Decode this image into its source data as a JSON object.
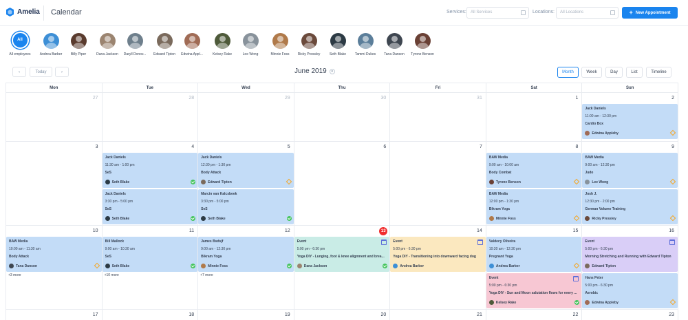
{
  "header": {
    "logo_text": "Amelia",
    "page_title": "Calendar",
    "services_label": "Services:",
    "services_placeholder": "All Services",
    "locations_label": "Locations:",
    "locations_placeholder": "All Locations",
    "new_button_label": "New Appointment",
    "accent_color": "#1a84ee"
  },
  "employees": [
    {
      "name": "All employees",
      "initials": "All",
      "selected": true
    },
    {
      "name": "Andrea Barber",
      "color": "#3d8fd6"
    },
    {
      "name": "Billy Piper",
      "color": "#5a3b2e"
    },
    {
      "name": "Dana Jackson",
      "color": "#9b8470"
    },
    {
      "name": "Daryll Donov...",
      "color": "#6e7f8c"
    },
    {
      "name": "Edward Tipton",
      "color": "#7a6a5c"
    },
    {
      "name": "Edwina Appl...",
      "color": "#a06b55"
    },
    {
      "name": "Kelsey Rake",
      "color": "#4e5a3a"
    },
    {
      "name": "Lee Wong",
      "color": "#88929b"
    },
    {
      "name": "Minnie Foss",
      "color": "#b07a4a"
    },
    {
      "name": "Ricky Pressley",
      "color": "#6b4a3c"
    },
    {
      "name": "Seth Blake",
      "color": "#2c3a44"
    },
    {
      "name": "Tammi Dukes",
      "color": "#5b7e9a"
    },
    {
      "name": "Tana Danson",
      "color": "#3e4650"
    },
    {
      "name": "Tyrone Benson",
      "color": "#6a4035"
    }
  ],
  "nav": {
    "prev": "‹",
    "today": "Today",
    "next": "›",
    "month_title": "June 2019",
    "dropdown": "▾",
    "views": [
      {
        "label": "Month",
        "active": true
      },
      {
        "label": "Week",
        "active": false
      },
      {
        "label": "Day",
        "active": false
      },
      {
        "label": "List",
        "active": false
      },
      {
        "label": "Timeline",
        "active": false
      }
    ]
  },
  "calendar": {
    "weekdays": [
      "Mon",
      "Tue",
      "Wed",
      "Thu",
      "Fri",
      "Sat",
      "Sun"
    ],
    "weeks": [
      {
        "days": [
          "27",
          "28",
          "29",
          "30",
          "31",
          "1",
          "2"
        ],
        "muted": [
          true,
          true,
          true,
          true,
          true,
          false,
          false
        ]
      },
      {
        "days": [
          "3",
          "4",
          "5",
          "6",
          "7",
          "8",
          "9"
        ]
      },
      {
        "days": [
          "10",
          "11",
          "12",
          "13",
          "14",
          "15",
          "16"
        ],
        "today_index": 3
      },
      {
        "days": [
          "17",
          "18",
          "19",
          "20",
          "21",
          "22",
          "23"
        ]
      }
    ],
    "more": [
      {
        "week": 2,
        "day": 0,
        "text": "+3 more"
      },
      {
        "week": 2,
        "day": 1,
        "text": "+10 more"
      },
      {
        "week": 2,
        "day": 2,
        "text": "+7 more"
      }
    ],
    "appointments": [
      {
        "week": 0,
        "day": 6,
        "slot": 0,
        "color": "blue",
        "title": "Jack Daniels",
        "time": "11:00 am - 12:30 pm",
        "service": "Cardio Box",
        "employee": "Edwina Appleby",
        "avatar": "#a06b55",
        "status": "pending"
      },
      {
        "week": 1,
        "day": 1,
        "slot": 0,
        "color": "blue",
        "title": "Jack Daniels",
        "time": "11:30 am - 1:00 pm",
        "service": "SeS",
        "employee": "Seth Blake",
        "avatar": "#2c3a44",
        "status": "ok"
      },
      {
        "week": 1,
        "day": 1,
        "slot": 1,
        "color": "blue",
        "title": "Jack Daniels",
        "time": "3:30 pm - 5:00 pm",
        "service": "SeS",
        "employee": "Seth Blake",
        "avatar": "#2c3a44",
        "status": "ok"
      },
      {
        "week": 1,
        "day": 2,
        "slot": 0,
        "color": "blue",
        "title": "Jack Daniels",
        "time": "12:30 pm - 1:30 pm",
        "service": "Body Attack",
        "employee": "Edward Tipton",
        "avatar": "#7a6a5c",
        "status": "pending"
      },
      {
        "week": 1,
        "day": 2,
        "slot": 1,
        "color": "blue",
        "title": "Marcin van Kalcsbeek",
        "time": "3:30 pm - 5:00 pm",
        "service": "SeS",
        "employee": "Seth Blake",
        "avatar": "#2c3a44",
        "status": "ok"
      },
      {
        "week": 1,
        "day": 5,
        "slot": 0,
        "color": "blue",
        "title": "BAW Media",
        "time": "9:00 am - 10:00 am",
        "service": "Body Combat",
        "employee": "Tyrone Benson",
        "avatar": "#6a4035",
        "status": "pending"
      },
      {
        "week": 1,
        "day": 5,
        "slot": 1,
        "color": "blue",
        "title": "BAW Media",
        "time": "12:00 pm - 1:30 pm",
        "service": "Bikram Yoga",
        "employee": "Minnie Foss",
        "avatar": "#b07a4a",
        "status": "pending"
      },
      {
        "week": 1,
        "day": 6,
        "slot": 0,
        "color": "blue",
        "title": "BAW Media",
        "time": "9:00 am - 12:30 pm",
        "service": "Judo",
        "employee": "Lee Wong",
        "avatar": "#88929b",
        "status": "pending"
      },
      {
        "week": 1,
        "day": 6,
        "slot": 1,
        "color": "blue",
        "title": "Josh J.",
        "time": "12:30 pm - 2:00 pm",
        "service": "German Volume Training",
        "employee": "Ricky Pressley",
        "avatar": "#6b4a3c",
        "status": "pending"
      },
      {
        "week": 2,
        "day": 0,
        "slot": 0,
        "color": "blue",
        "title": "BAW Media",
        "time": "10:00 am - 11:30 am",
        "service": "Body Attack",
        "employee": "Tana Danson",
        "avatar": "#3e4650",
        "status": "pending"
      },
      {
        "week": 2,
        "day": 1,
        "slot": 0,
        "color": "blue",
        "title": "Bill Mallock",
        "time": "9:00 am - 10:30 am",
        "service": "SeS",
        "employee": "Seth Blake",
        "avatar": "#2c3a44",
        "status": "ok"
      },
      {
        "week": 2,
        "day": 2,
        "slot": 0,
        "color": "blue",
        "title": "James Bsdsjf",
        "time": "9:00 am - 12:30 pm",
        "service": "Bikram Yoga",
        "employee": "Minnie Foss",
        "avatar": "#b07a4a",
        "status": "ok"
      },
      {
        "week": 2,
        "day": 3,
        "slot": 0,
        "color": "teal",
        "title": "Event",
        "time": "5:00 pm - 6:30 pm",
        "service": "Yoga DIY - Lunging, foot & knee alignment and brea...",
        "employee": "Dana Jackson",
        "avatar": "#9b8470",
        "status": "ok",
        "event": true
      },
      {
        "week": 2,
        "day": 4,
        "slot": 0,
        "color": "yellow",
        "title": "Event",
        "time": "5:00 pm - 6:30 pm",
        "service": "Yoga DIY - Transitioning into downward facing dog",
        "employee": "Andrea Barber",
        "avatar": "#3d8fd6",
        "status": "none",
        "event": true
      },
      {
        "week": 2,
        "day": 5,
        "slot": 0,
        "color": "blue",
        "title": "Valdecy Oliveira",
        "time": "10:30 am - 12:30 pm",
        "service": "Pregnant Yoga",
        "employee": "Andrea Barber",
        "avatar": "#3d8fd6",
        "status": "pending"
      },
      {
        "week": 2,
        "day": 5,
        "slot": 1,
        "color": "pink",
        "title": "Event",
        "time": "5:00 pm - 6:30 pm",
        "service": "Yoga DIY - Sun and Moon salutation flows for every ...",
        "employee": "Kelsey Rake",
        "avatar": "#4e5a3a",
        "status": "ok",
        "event": true
      },
      {
        "week": 2,
        "day": 6,
        "slot": 0,
        "color": "purple",
        "title": "Event",
        "time": "5:00 pm - 6:30 pm",
        "service": "Morning Stretching and Running with Edward Tipton",
        "employee": "Edward Tipton",
        "avatar": "#7a6a5c",
        "status": "none",
        "event": true
      },
      {
        "week": 2,
        "day": 6,
        "slot": 1,
        "color": "blue",
        "title": "Hans Peter",
        "time": "5:00 pm - 6:30 pm",
        "service": "Aerobic",
        "employee": "Edwina Appleby",
        "avatar": "#a06b55",
        "status": "pending"
      }
    ]
  }
}
